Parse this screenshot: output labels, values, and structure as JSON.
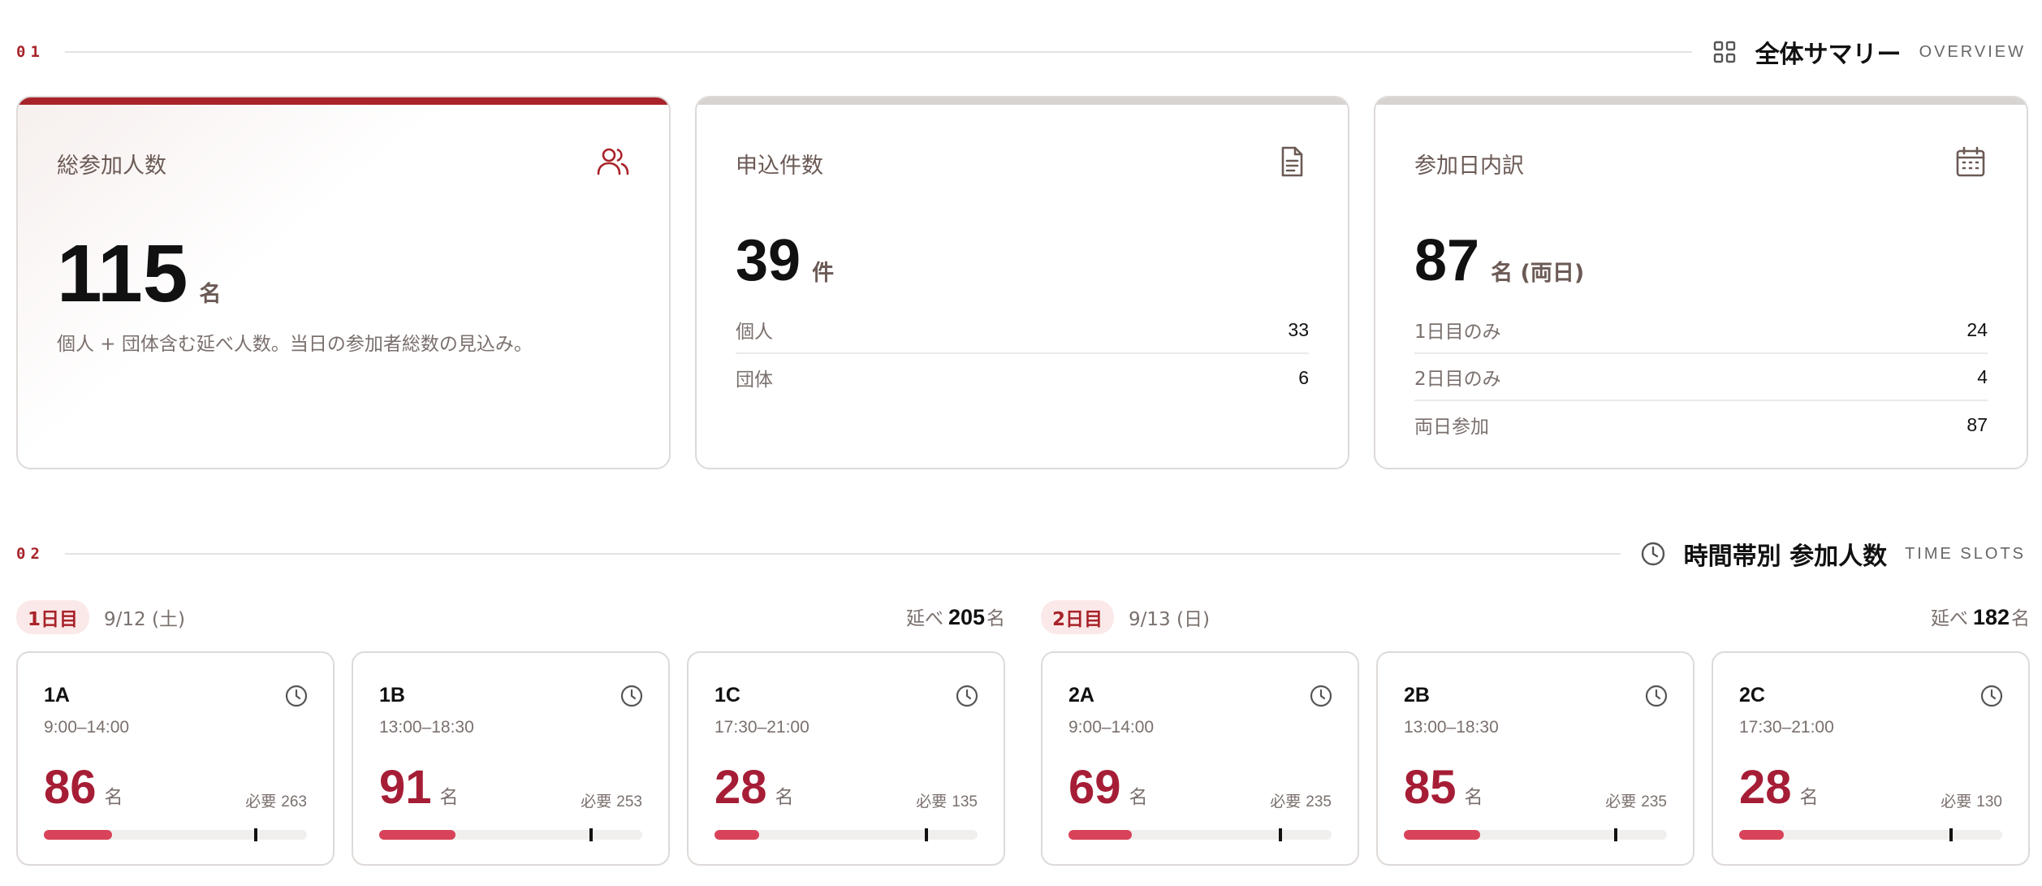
{
  "section1": {
    "num": "01",
    "icon": "grid-icon",
    "title": "全体サマリー",
    "subtitle": "OVERVIEW"
  },
  "cards": {
    "total": {
      "label": "総参加人数",
      "icon": "users-icon",
      "value": "115",
      "unit": "名",
      "note": "個人 + 団体含む延べ人数。当日の参加者総数の見込み。"
    },
    "applications": {
      "label": "申込件数",
      "icon": "document-icon",
      "value": "39",
      "unit": "件",
      "rows": [
        {
          "label": "個人",
          "value": "33"
        },
        {
          "label": "団体",
          "value": "6"
        }
      ]
    },
    "days": {
      "label": "参加日内訳",
      "icon": "calendar-icon",
      "value": "87",
      "unit": "名 (両日)",
      "rows": [
        {
          "label": "1日目のみ",
          "value": "24"
        },
        {
          "label": "2日目のみ",
          "value": "4"
        },
        {
          "label": "両日参加",
          "value": "87"
        }
      ]
    }
  },
  "section2": {
    "num": "02",
    "icon": "clock-icon",
    "title": "時間帯別 参加人数",
    "subtitle": "TIME SLOTS"
  },
  "day1": {
    "badge": "1日目",
    "date": "9/12 (土)",
    "total_prefix": "延べ",
    "total": "205",
    "total_unit": "名",
    "slots": [
      {
        "name": "1A",
        "time": "9:00–14:00",
        "count": "86",
        "unit": "名",
        "need_label": "必要",
        "need": "263",
        "fill": 0.26
      },
      {
        "name": "1B",
        "time": "13:00–18:30",
        "count": "91",
        "unit": "名",
        "need_label": "必要",
        "need": "253",
        "fill": 0.29
      },
      {
        "name": "1C",
        "time": "17:30–21:00",
        "count": "28",
        "unit": "名",
        "need_label": "必要",
        "need": "135",
        "fill": 0.17
      }
    ]
  },
  "day2": {
    "badge": "2日目",
    "date": "9/13 (日)",
    "total_prefix": "延べ",
    "total": "182",
    "total_unit": "名",
    "slots": [
      {
        "name": "2A",
        "time": "9:00–14:00",
        "count": "69",
        "unit": "名",
        "need_label": "必要",
        "need": "235",
        "fill": 0.24
      },
      {
        "name": "2B",
        "time": "13:00–18:30",
        "count": "85",
        "unit": "名",
        "need_label": "必要",
        "need": "235",
        "fill": 0.29
      },
      {
        "name": "2C",
        "time": "17:30–21:00",
        "count": "28",
        "unit": "名",
        "need_label": "必要",
        "need": "130",
        "fill": 0.17
      }
    ]
  },
  "colors": {
    "accent": "#a8232a",
    "count": "#a61d36",
    "bar": "#d94359"
  }
}
